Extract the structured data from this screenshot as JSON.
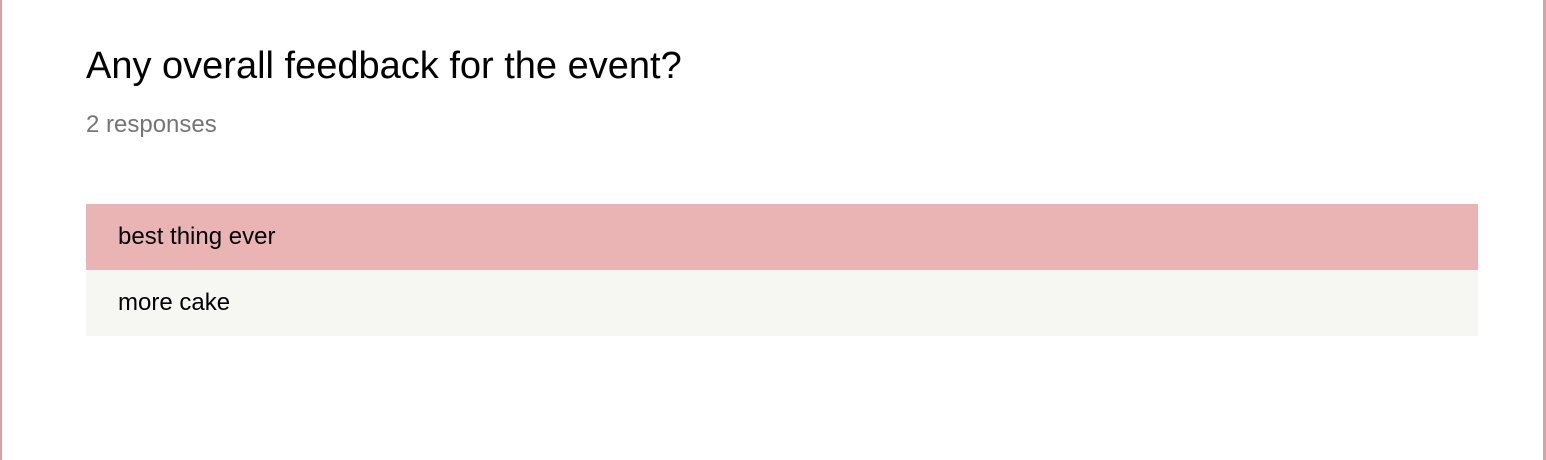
{
  "question": {
    "title": "Any overall feedback for the event?",
    "response_count": "2 responses"
  },
  "responses": [
    {
      "text": "best thing ever",
      "highlighted": true
    },
    {
      "text": "more cake",
      "highlighted": false
    }
  ],
  "colors": {
    "highlight_row": "#eab4b4",
    "plain_row": "#f6f6f3",
    "border_accent": "#d6a2a2",
    "secondary_text": "#757575"
  }
}
